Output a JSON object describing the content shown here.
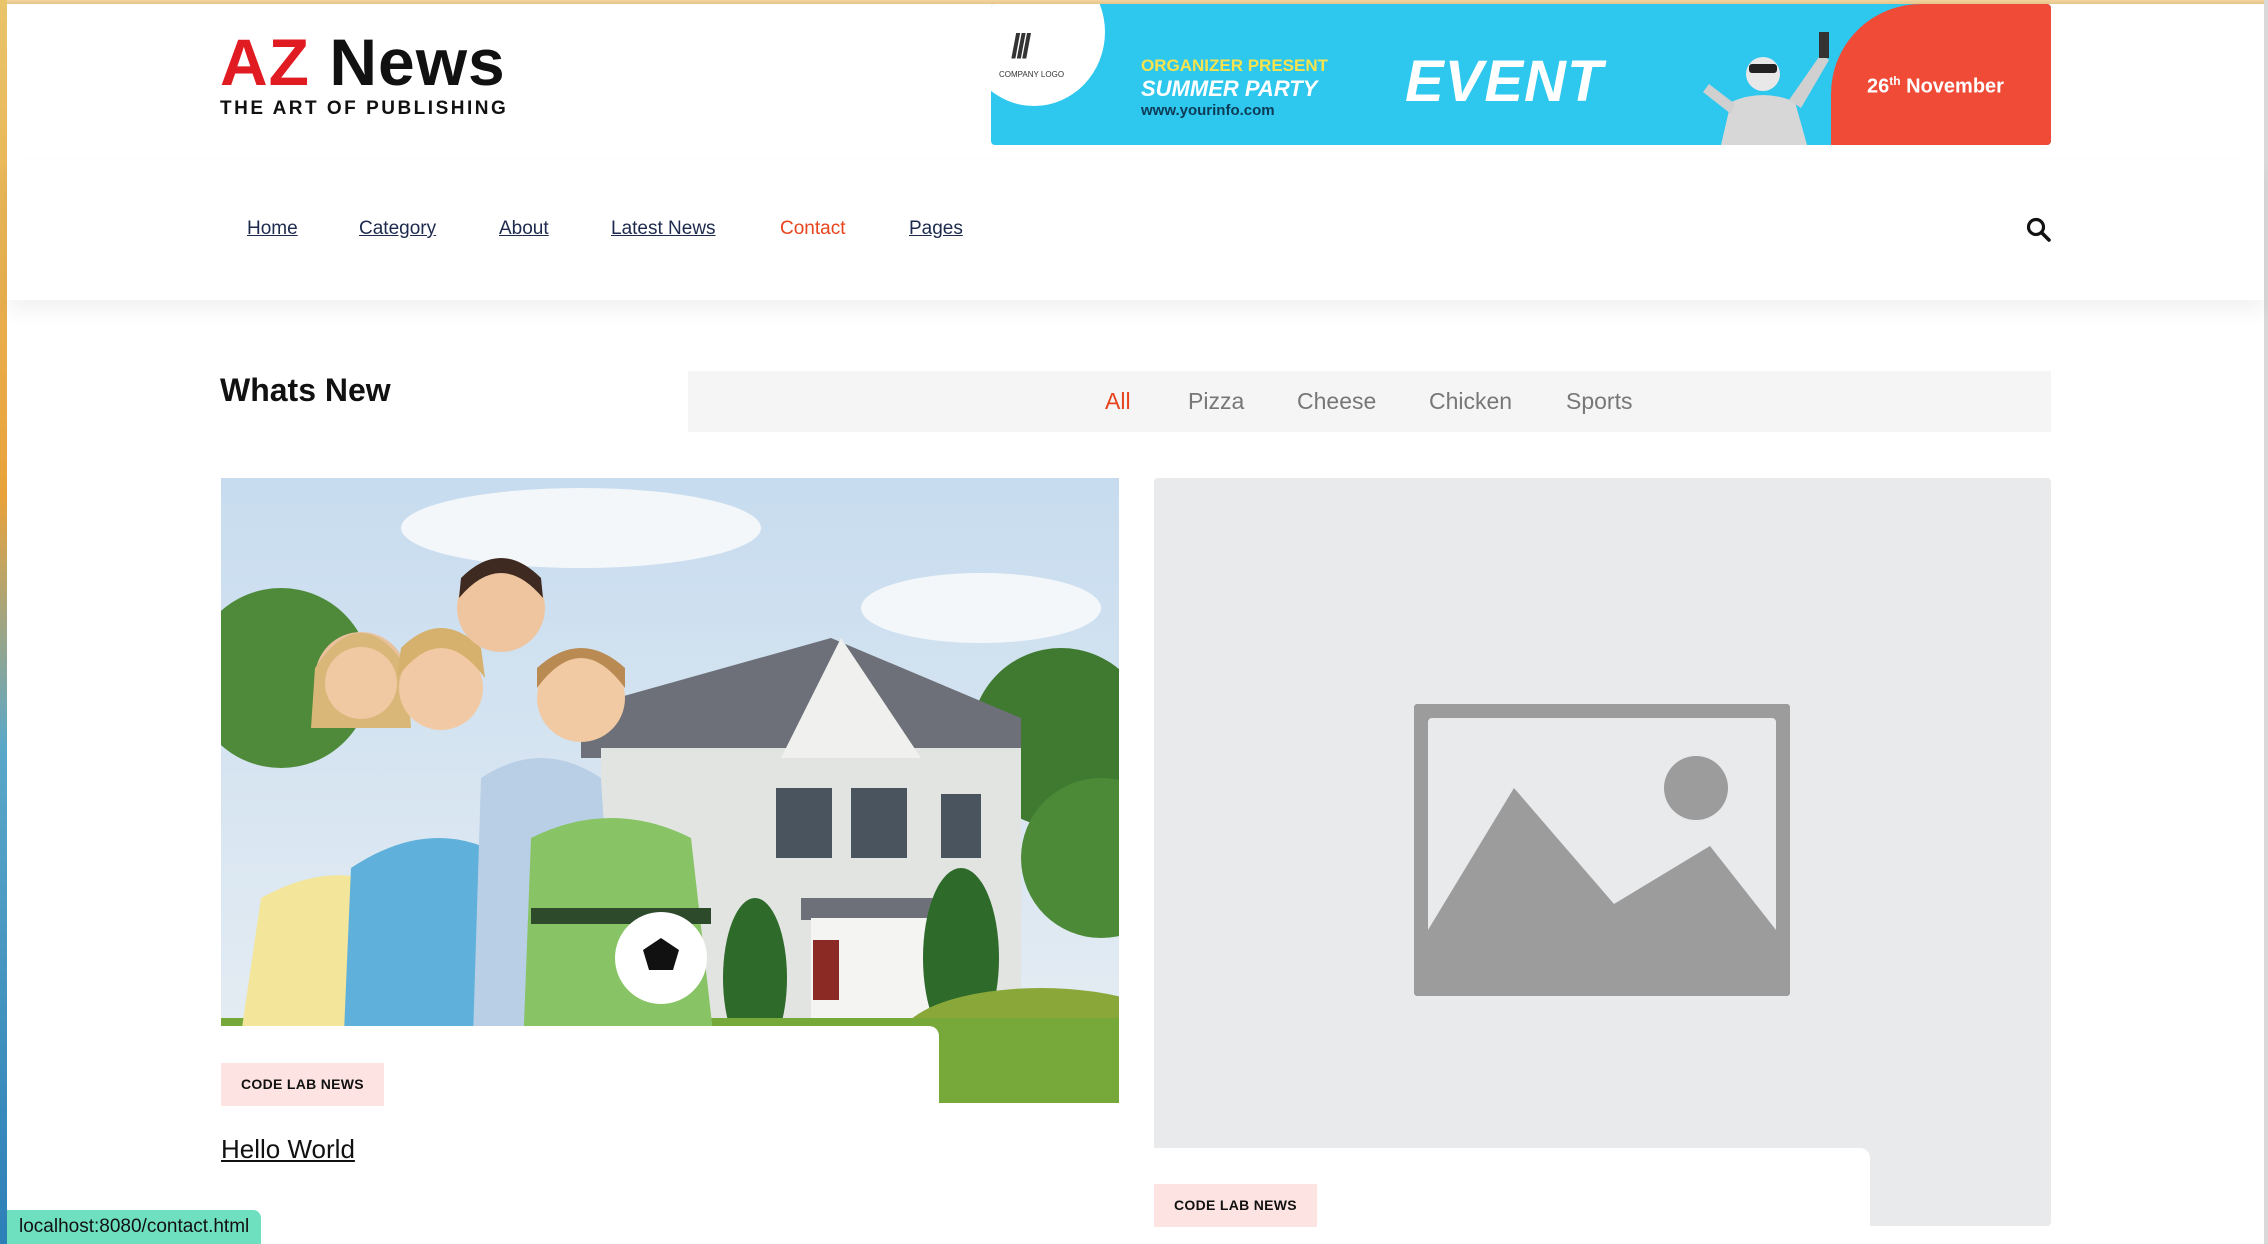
{
  "header": {
    "logo_accent": "AZ",
    "logo_word": "News",
    "tagline": "THE ART OF PUBLISHING",
    "banner": {
      "company_logo_text": "COMPANY LOGO",
      "organizer": "ORGANIZER PRESENT",
      "title": "SUMMER PARTY",
      "website": "www.yourinfo.com",
      "event": "EVENT",
      "date_day": "26",
      "date_suffix": "th",
      "date_month": "November"
    }
  },
  "nav": {
    "items": [
      {
        "label": "Home"
      },
      {
        "label": "Category"
      },
      {
        "label": "About"
      },
      {
        "label": "Latest News"
      },
      {
        "label": "Contact"
      },
      {
        "label": "Pages"
      }
    ],
    "active": "Contact",
    "search_icon": "search-icon"
  },
  "section": {
    "title": "Whats New",
    "filters": [
      "All",
      "Pizza",
      "Cheese",
      "Chicken",
      "Sports"
    ],
    "active_filter": "All"
  },
  "cards": [
    {
      "category": "CODE LAB NEWS",
      "title": "Hello World",
      "image": "family-photo"
    },
    {
      "category": "CODE LAB NEWS",
      "title": "",
      "image": "image-placeholder-icon"
    }
  ],
  "status_bar": {
    "url": "localhost:8080/contact.html"
  },
  "colors": {
    "accent": "#e8441c",
    "logo_red": "#e01b22",
    "nav_text": "#1d2a4d",
    "banner_blue": "#2ec7ee",
    "banner_red": "#ef4b37",
    "badge_bg": "#fde4e2",
    "placeholder_bg": "#e9eaec"
  }
}
